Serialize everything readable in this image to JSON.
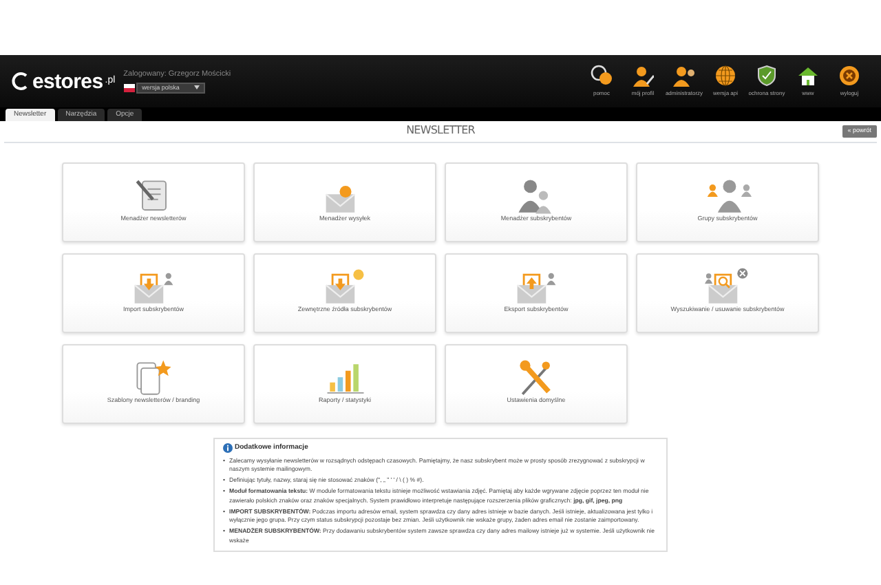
{
  "header": {
    "logo": "estores",
    "logo_suffix": ".pl",
    "logged_in": "Zalogowany: Grzegorz Mościcki",
    "language": "wersja polska",
    "actions": [
      {
        "label": "pomoc"
      },
      {
        "label": "mój profil"
      },
      {
        "label": "administratorzy"
      },
      {
        "label": "wersja api"
      },
      {
        "label": "ochrona strony"
      },
      {
        "label": "www"
      },
      {
        "label": "wyloguj"
      }
    ]
  },
  "tabs": [
    {
      "label": "Newsletter",
      "selected": true
    },
    {
      "label": "Narzędzia",
      "selected": false
    },
    {
      "label": "Opcje",
      "selected": false
    }
  ],
  "page": {
    "title": "NEWSLETTER",
    "back_button": "« powrót"
  },
  "tiles": [
    {
      "label": "Menadżer newsletterów"
    },
    {
      "label": "Menadżer wysyłek"
    },
    {
      "label": "Menadżer subskrybentów"
    },
    {
      "label": "Grupy subskrybentów"
    },
    {
      "label": "Import subskrybentów"
    },
    {
      "label": "Zewnętrzne źródła subskrybentów"
    },
    {
      "label": "Eksport subskrybentów"
    },
    {
      "label": "Wyszukiwanie / usuwanie subskrybentów"
    },
    {
      "label": "Szablony newsletterów / branding"
    },
    {
      "label": "Raporty / statystyki"
    },
    {
      "label": "Ustawienia domyślne"
    }
  ],
  "info": {
    "title": "Dodatkowe informacje",
    "bullet": "•",
    "items": [
      "Zalecamy wysyłanie newsletterów w rozsądnych odstępach czasowych. Pamiętajmy, że nasz subskrybent może w prosty sposób zrezygnować z subskrypcji w naszym systemie mailingowym.",
      "Definiując tytuły, nazwy, staraj się nie stosować znaków (\", „ ” ' ' / \\ ( ) % #).",
      "**Moduł formatowania tekstu:** W module formatowania tekstu istnieje możliwość wstawiania zdjęć. Pamiętaj aby każde wgrywane zdjęcie poprzez ten moduł nie zawierało polskich znaków oraz znaków specjalnych. System prawidłowo interpretuje następujące rozszerzenia plików graficznych: **jpg, gif, jpeg, png**",
      "**IMPORT SUBSKRYBENTÓW:** Podczas importu adresów email, system sprawdza czy dany adres istnieje w bazie danych. Jeśli istnieje, aktualizowana jest tylko i wyłącznie jego grupa. Przy czym status subskrypcji pozostaje bez zmian. Jeśli użytkownik nie wskaże grupy, żaden adres email nie zostanie zaimportowany.",
      "**MENADŻER SUBSKRYBENTÓW:** Przy dodawaniu subskrybentów system zawsze sprawdza czy dany adres mailowy istnieje już w systemie. Jeśli użytkownik nie wskaże"
    ]
  }
}
